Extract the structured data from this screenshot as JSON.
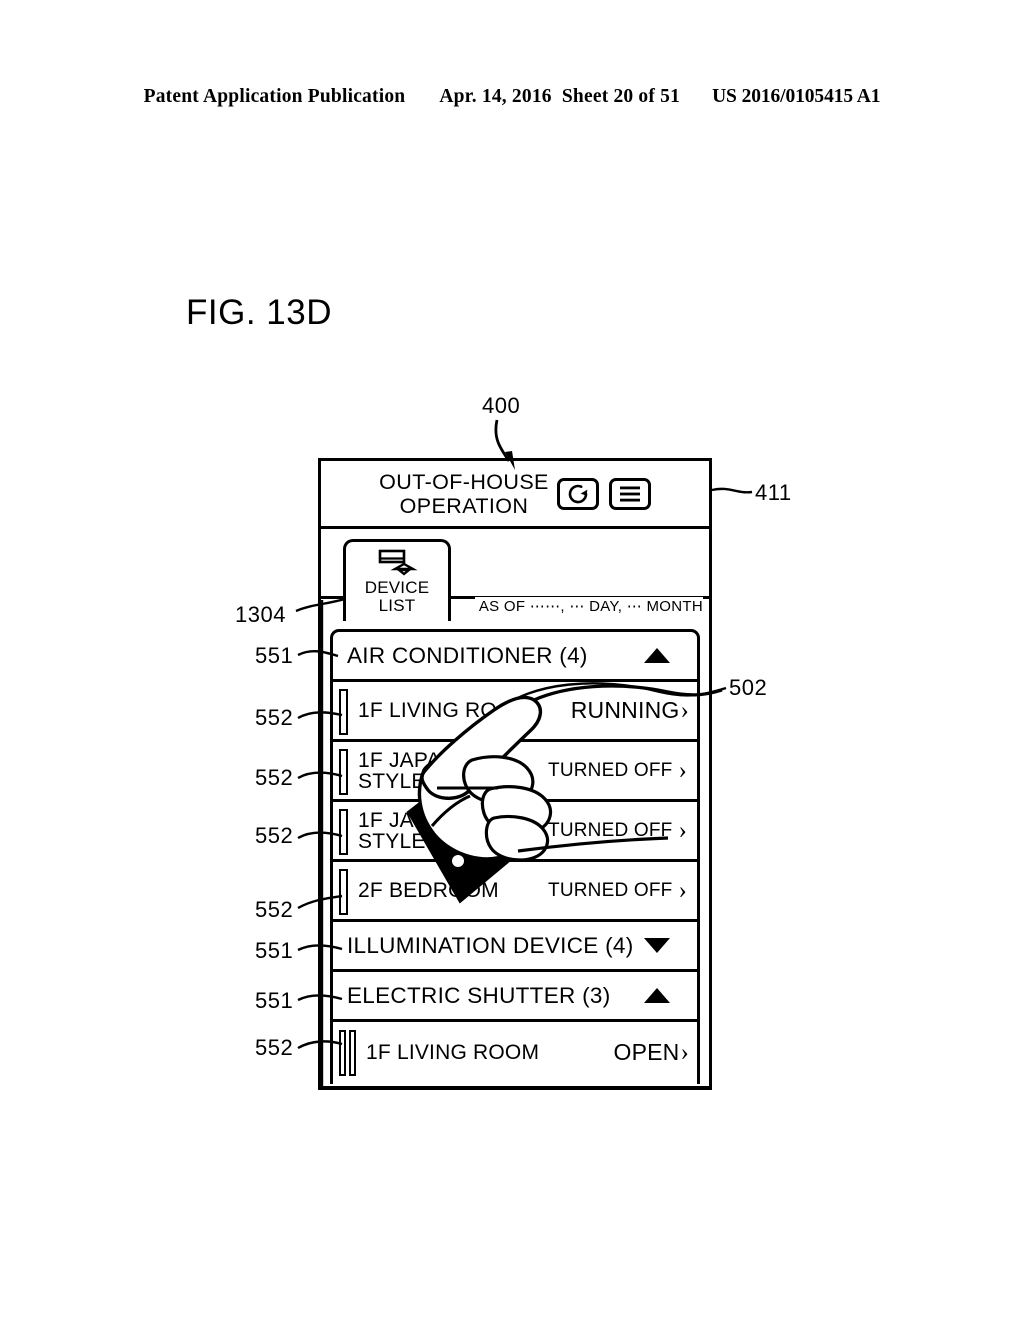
{
  "publication_header": {
    "left": "Patent Application Publication",
    "date": "Apr. 14, 2016",
    "sheet": "Sheet 20 of 51",
    "number": "US 2016/0105415 A1"
  },
  "figure": {
    "label": "FIG. 13D"
  },
  "callouts": [
    {
      "id": "400",
      "text": "400"
    },
    {
      "id": "411",
      "text": "411"
    },
    {
      "id": "1304",
      "text": "1304"
    },
    {
      "id": "502",
      "text": "502"
    },
    {
      "id": "551a",
      "text": "551"
    },
    {
      "id": "552a",
      "text": "552"
    },
    {
      "id": "552b",
      "text": "552"
    },
    {
      "id": "552c",
      "text": "552"
    },
    {
      "id": "552d",
      "text": "552"
    },
    {
      "id": "551b",
      "text": "551"
    },
    {
      "id": "551c",
      "text": "551"
    },
    {
      "id": "552e",
      "text": "552"
    }
  ],
  "device": {
    "titlebar": {
      "title": "OUT-OF-HOUSE\nOPERATION",
      "refresh_icon": "refresh-icon",
      "menu_icon": "hamburger-menu-icon"
    },
    "tab": {
      "label": "DEVICE\nLIST",
      "icon": "air-conditioner-and-lamp-icon"
    },
    "timestamp": "AS OF ⋯⋯, ⋯ DAY, ⋯ MONTH",
    "groups": [
      {
        "label": "AIR CONDITIONER (4)",
        "expanded": true,
        "toggle_icon": "triangle-up-icon",
        "devices": [
          {
            "name": "1F LIVING ROOM",
            "state": "RUNNING",
            "chevron": "›",
            "bars": 1,
            "emphasis": true
          },
          {
            "name": "1F JAPANESE\nSTYLE ROOM",
            "state": "TURNED OFF",
            "chevron": "›",
            "bars": 1,
            "emphasis": false
          },
          {
            "name": "1F JAPANESE\nSTYLE ROOM",
            "state": "TURNED OFF",
            "chevron": "›",
            "bars": 1,
            "emphasis": false
          },
          {
            "name": "2F BEDROOM",
            "state": "TURNED OFF",
            "chevron": "›",
            "bars": 1,
            "emphasis": false
          }
        ]
      },
      {
        "label": "ILLUMINATION DEVICE (4)",
        "expanded": false,
        "toggle_icon": "triangle-down-icon",
        "devices": []
      },
      {
        "label": "ELECTRIC SHUTTER (3)",
        "expanded": true,
        "toggle_icon": "triangle-up-icon",
        "devices": [
          {
            "name": "1F LIVING ROOM",
            "state": "OPEN",
            "chevron": "›",
            "bars": 2,
            "emphasis": true
          }
        ]
      }
    ]
  },
  "annotation": {
    "pointing_hand": "pointing-hand-icon",
    "arrow_to_device": "curved-arrow-icon"
  },
  "colors": {
    "ink": "#000000",
    "paper": "#ffffff"
  }
}
